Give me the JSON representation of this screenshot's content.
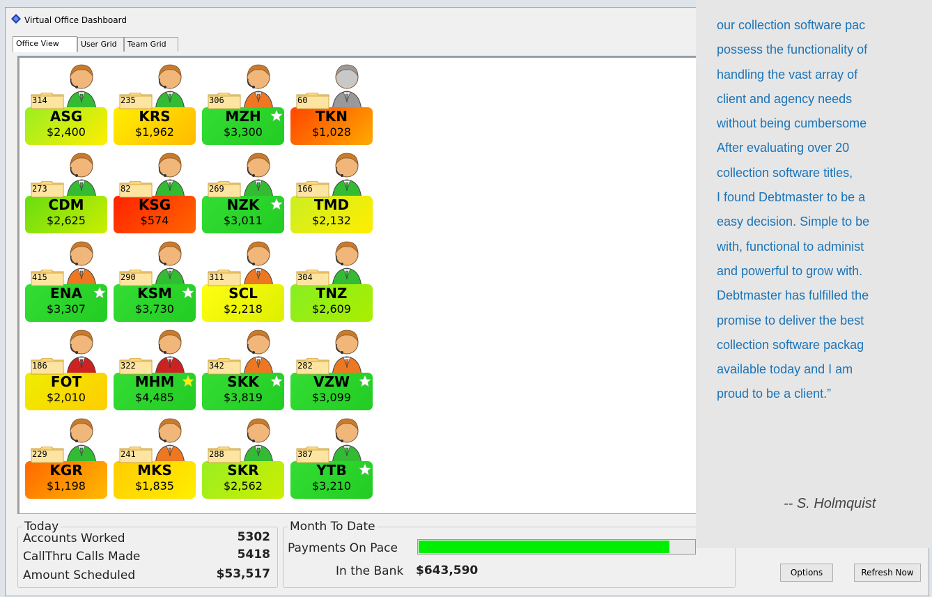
{
  "window": {
    "title": "Virtual Office Dashboard"
  },
  "tabs": [
    {
      "label": "Office View",
      "active": true
    },
    {
      "label": "User Grid",
      "active": false
    },
    {
      "label": "Team Grid",
      "active": false
    }
  ],
  "agents": [
    {
      "code": "ASG",
      "amount": "$2,400",
      "count": "314",
      "status": "green",
      "card": [
        "#99ee22",
        "#ffee00"
      ],
      "star": false
    },
    {
      "code": "KRS",
      "amount": "$1,962",
      "count": "235",
      "status": "green",
      "card": [
        "#ffee00",
        "#ffbb00"
      ],
      "star": false
    },
    {
      "code": "MZH",
      "amount": "$3,300",
      "count": "306",
      "status": "orange",
      "card": [
        "#33dd33",
        "#22cc22"
      ],
      "star": true
    },
    {
      "code": "TKN",
      "amount": "$1,028",
      "count": "60",
      "status": "gray",
      "card": [
        "#ff4400",
        "#ffaa00"
      ],
      "star": false
    },
    {
      "code": "CDM",
      "amount": "$2,625",
      "count": "273",
      "status": "green",
      "card": [
        "#66dd11",
        "#ccee00"
      ],
      "star": false
    },
    {
      "code": "KSG",
      "amount": "$574",
      "count": "82",
      "status": "green",
      "card": [
        "#ff2200",
        "#ff6600"
      ],
      "star": false
    },
    {
      "code": "NZK",
      "amount": "$3,011",
      "count": "269",
      "status": "green",
      "card": [
        "#33dd33",
        "#22cc22"
      ],
      "star": true
    },
    {
      "code": "TMD",
      "amount": "$2,132",
      "count": "166",
      "status": "green",
      "card": [
        "#ccee22",
        "#ffee00"
      ],
      "star": false
    },
    {
      "code": "ENA",
      "amount": "$3,307",
      "count": "415",
      "status": "orange",
      "card": [
        "#33dd33",
        "#22cc22"
      ],
      "star": true
    },
    {
      "code": "KSM",
      "amount": "$3,730",
      "count": "290",
      "status": "green",
      "card": [
        "#33dd33",
        "#22cc22"
      ],
      "star": true
    },
    {
      "code": "SCL",
      "amount": "$2,218",
      "count": "311",
      "status": "orange",
      "card": [
        "#ffff11",
        "#ddee00"
      ],
      "star": false
    },
    {
      "code": "TNZ",
      "amount": "$2,609",
      "count": "304",
      "status": "green",
      "card": [
        "#88ee22",
        "#aaee00"
      ],
      "star": false
    },
    {
      "code": "FOT",
      "amount": "$2,010",
      "count": "186",
      "status": "red",
      "card": [
        "#eeee00",
        "#ffcc00"
      ],
      "star": false
    },
    {
      "code": "MHM",
      "amount": "$4,485",
      "count": "322",
      "status": "red",
      "card": [
        "#33dd33",
        "#22cc22"
      ],
      "star": true,
      "star_color": "#ffee00"
    },
    {
      "code": "SKK",
      "amount": "$3,819",
      "count": "342",
      "status": "orange",
      "card": [
        "#33dd33",
        "#22cc22"
      ],
      "star": true
    },
    {
      "code": "VZW",
      "amount": "$3,099",
      "count": "282",
      "status": "orange",
      "card": [
        "#33dd33",
        "#22cc22"
      ],
      "star": true
    },
    {
      "code": "KGR",
      "amount": "$1,198",
      "count": "229",
      "status": "green",
      "card": [
        "#ff6600",
        "#ffbb00"
      ],
      "star": false
    },
    {
      "code": "MKS",
      "amount": "$1,835",
      "count": "241",
      "status": "orange",
      "card": [
        "#ffcc00",
        "#ffee00"
      ],
      "star": false
    },
    {
      "code": "SKR",
      "amount": "$2,562",
      "count": "288",
      "status": "green",
      "card": [
        "#99ee22",
        "#ccee00"
      ],
      "star": false
    },
    {
      "code": "YTB",
      "amount": "$3,210",
      "count": "387",
      "status": "green",
      "card": [
        "#33dd33",
        "#22cc22"
      ],
      "star": true
    }
  ],
  "today": {
    "legend": "Today",
    "accounts_label": "Accounts Worked",
    "accounts_value": "5302",
    "calls_label": "CallThru Calls Made",
    "calls_value": "5418",
    "scheduled_label": "Amount Scheduled",
    "scheduled_value": "$53,517"
  },
  "mtd": {
    "legend": "Month To Date",
    "pace_label": "Payments On Pace",
    "pace_fill": 0.91,
    "bank_label": "In the Bank",
    "bank_value": "$643,590"
  },
  "buttons": {
    "options": "Options",
    "refresh": "Refresh Now"
  },
  "quote": {
    "lines": [
      "our collection software pac",
      "possess the functionality of",
      "handling the vast array of",
      "client and agency needs",
      "without being cumbersome",
      "After evaluating over 20",
      "collection software titles,",
      "I found Debtmaster to be a",
      "easy decision. Simple to be",
      "with, functional to administ",
      "and powerful to grow with.",
      "Debtmaster has fulfilled the",
      "promise to deliver the best",
      "collection software packag",
      "available today and I am",
      "proud to be a client.”"
    ],
    "signature": "-- S. Holmquist"
  },
  "colors": {
    "status_green": "#33bb33",
    "status_orange": "#ee7722",
    "status_red": "#cc2222",
    "status_gray": "#999999"
  }
}
